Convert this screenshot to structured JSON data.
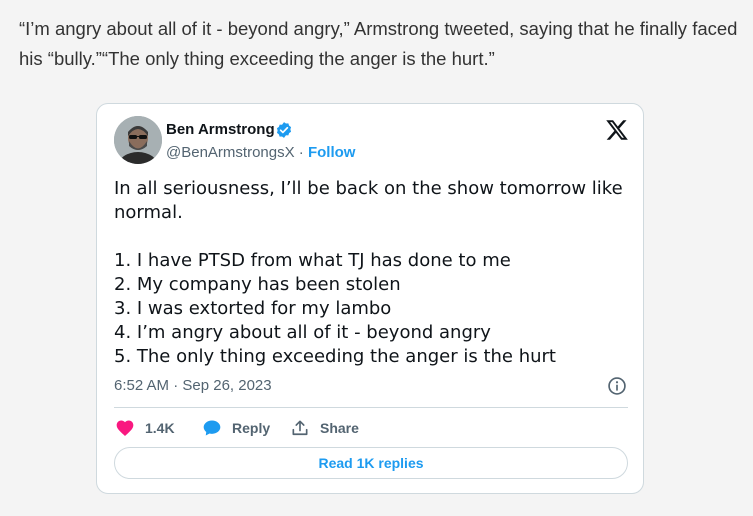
{
  "article": {
    "paragraph": "“I’m angry about all of it - beyond angry,” Armstrong tweeted, saying that he finally faced his “bully.”“The only thing exceeding the anger is the hurt.”"
  },
  "tweet": {
    "author_name": "Ben Armstrong",
    "handle": "@BenArmstrongsX",
    "separator": " · ",
    "follow_label": "Follow",
    "body_lines_1": [
      "In all seriousness, I’ll be back on the show tomorrow like normal."
    ],
    "body_lines_2": [
      "1. I have PTSD from what TJ has done to me",
      "2. My company has been stolen",
      "3. I was extorted for my lambo",
      "4. I’m angry about all of it - beyond angry",
      "5. The only thing exceeding the anger is the hurt"
    ],
    "timestamp": "6:52 AM · Sep 26, 2023",
    "likes_count": "1.4K",
    "reply_label": "Reply",
    "share_label": "Share",
    "replies_button_label": "Read 1K replies"
  },
  "icons": {
    "verified": "verified-badge-icon",
    "x_logo": "x-logo-icon",
    "info": "info-icon",
    "like": "heart-icon",
    "reply": "speech-bubble-icon",
    "share": "share-upload-icon"
  },
  "colors": {
    "accent": "#1d9bf0",
    "like": "#f91880",
    "text_primary": "#0f1419",
    "text_secondary": "#536471",
    "border": "#cfd9de",
    "page_background": "#f4f4f4"
  }
}
